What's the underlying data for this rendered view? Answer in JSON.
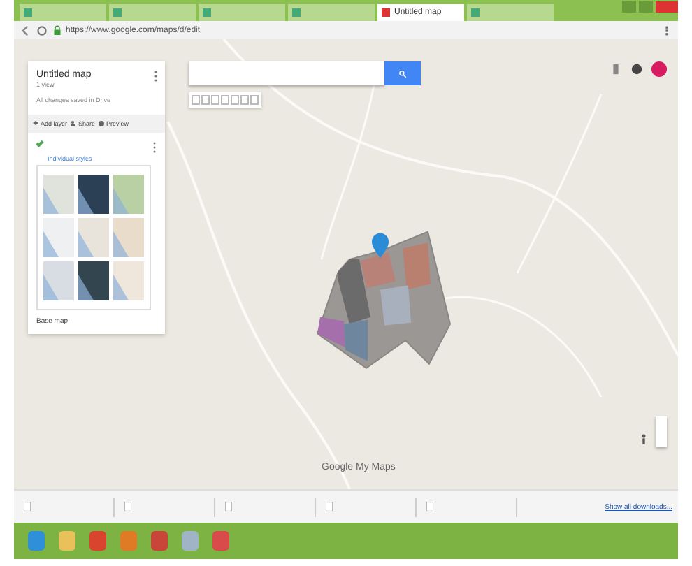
{
  "browser": {
    "tabs": [
      {
        "selected": false
      },
      {
        "selected": false
      },
      {
        "selected": false
      },
      {
        "selected": false
      },
      {
        "title": "Untitled map",
        "selected": true
      },
      {
        "selected": false
      }
    ],
    "url": "https://www.google.com/maps/d/edit"
  },
  "map_panel": {
    "title": "Untitled map",
    "subtitle": "1 view",
    "status": "All changes saved in Drive",
    "actions": [
      {
        "label": "Add layer",
        "kind": "layer"
      },
      {
        "label": "Share",
        "kind": "share"
      },
      {
        "label": "Preview",
        "kind": "preview"
      }
    ],
    "layer": {
      "checked": true,
      "style_link": "Individual styles"
    },
    "base_map_styles": [
      {
        "color": "#dfe3dc"
      },
      {
        "color": "#2b3f55"
      },
      {
        "color": "#b9cfa4"
      },
      {
        "color": "#eef0f2"
      },
      {
        "color": "#e8e4dc"
      },
      {
        "color": "#e9dccb"
      },
      {
        "color": "#d8dde3"
      },
      {
        "color": "#33454e"
      },
      {
        "color": "#efe6dc"
      }
    ],
    "base_map_label": "Base map"
  },
  "map": {
    "logo": "Google My Maps"
  },
  "downloads": {
    "count_items": [
      {
        "kind": "file"
      },
      {
        "kind": "file"
      },
      {
        "kind": "file"
      },
      {
        "kind": "file"
      },
      {
        "kind": "file"
      }
    ],
    "show_all": "Show all downloads..."
  },
  "taskbar": {
    "apps": [
      {
        "color": "#2f8fd8"
      },
      {
        "color": "#e8c15a"
      },
      {
        "color": "#d9442f"
      },
      {
        "color": "#e07b25"
      },
      {
        "color": "#c9453a"
      },
      {
        "color": "#9fb4c4"
      },
      {
        "color": "#d94a4a"
      }
    ]
  }
}
